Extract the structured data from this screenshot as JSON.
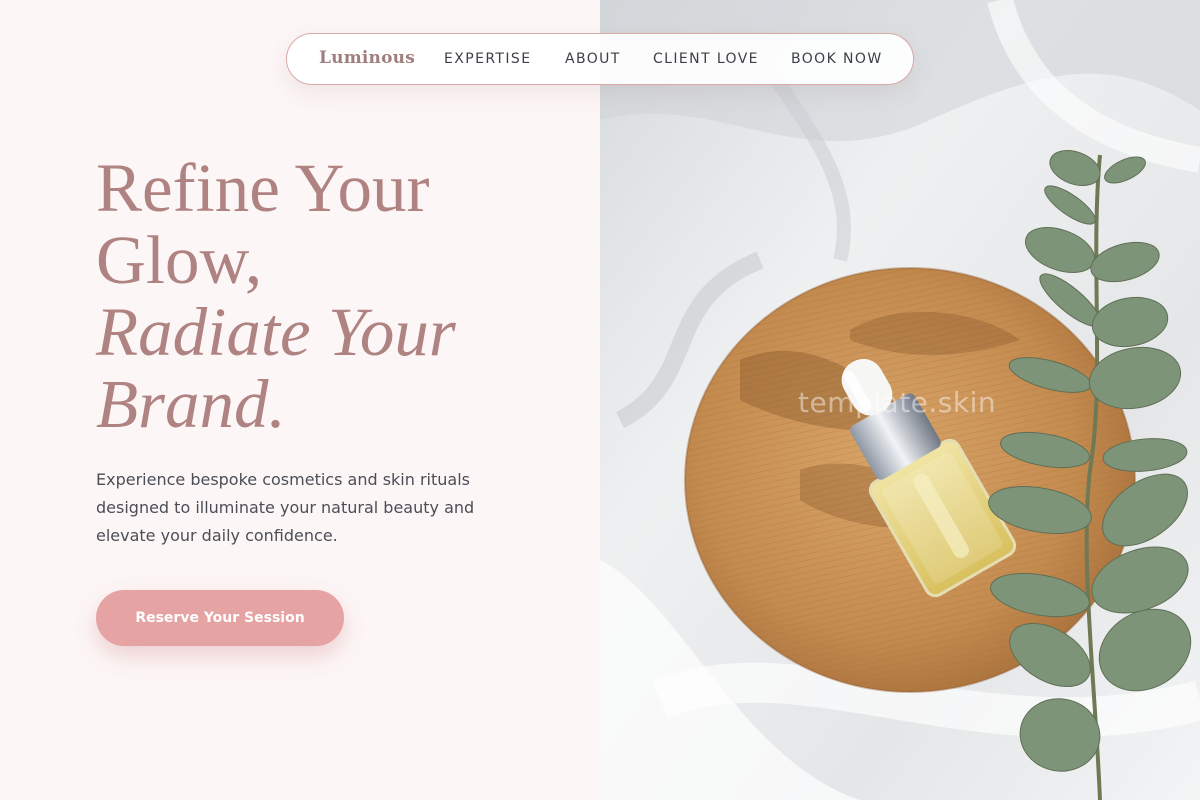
{
  "nav": {
    "logo": "Luminous",
    "items": [
      {
        "label": "EXPERTISE"
      },
      {
        "label": "ABOUT"
      },
      {
        "label": "CLIENT LOVE"
      },
      {
        "label": "BOOK NOW"
      }
    ]
  },
  "hero": {
    "title_line1": "Refine Your",
    "title_line2": "Glow,",
    "title_line3": "Radiate Your",
    "title_line4": "Brand.",
    "description": "Experience bespoke cosmetics and skin rituals designed to illuminate your natural beauty and elevate your daily confidence.",
    "cta_label": "Reserve Your Session"
  },
  "image": {
    "watermark": "template.skin",
    "alt": "Serum dropper bottle on a bamboo tray with eucalyptus sprig on white linen"
  },
  "colors": {
    "background": "#fdf6f6",
    "accent": "#e5a3a3",
    "title": "#b08383",
    "nav_text": "#3d4049",
    "body_text": "#4b4e57"
  }
}
